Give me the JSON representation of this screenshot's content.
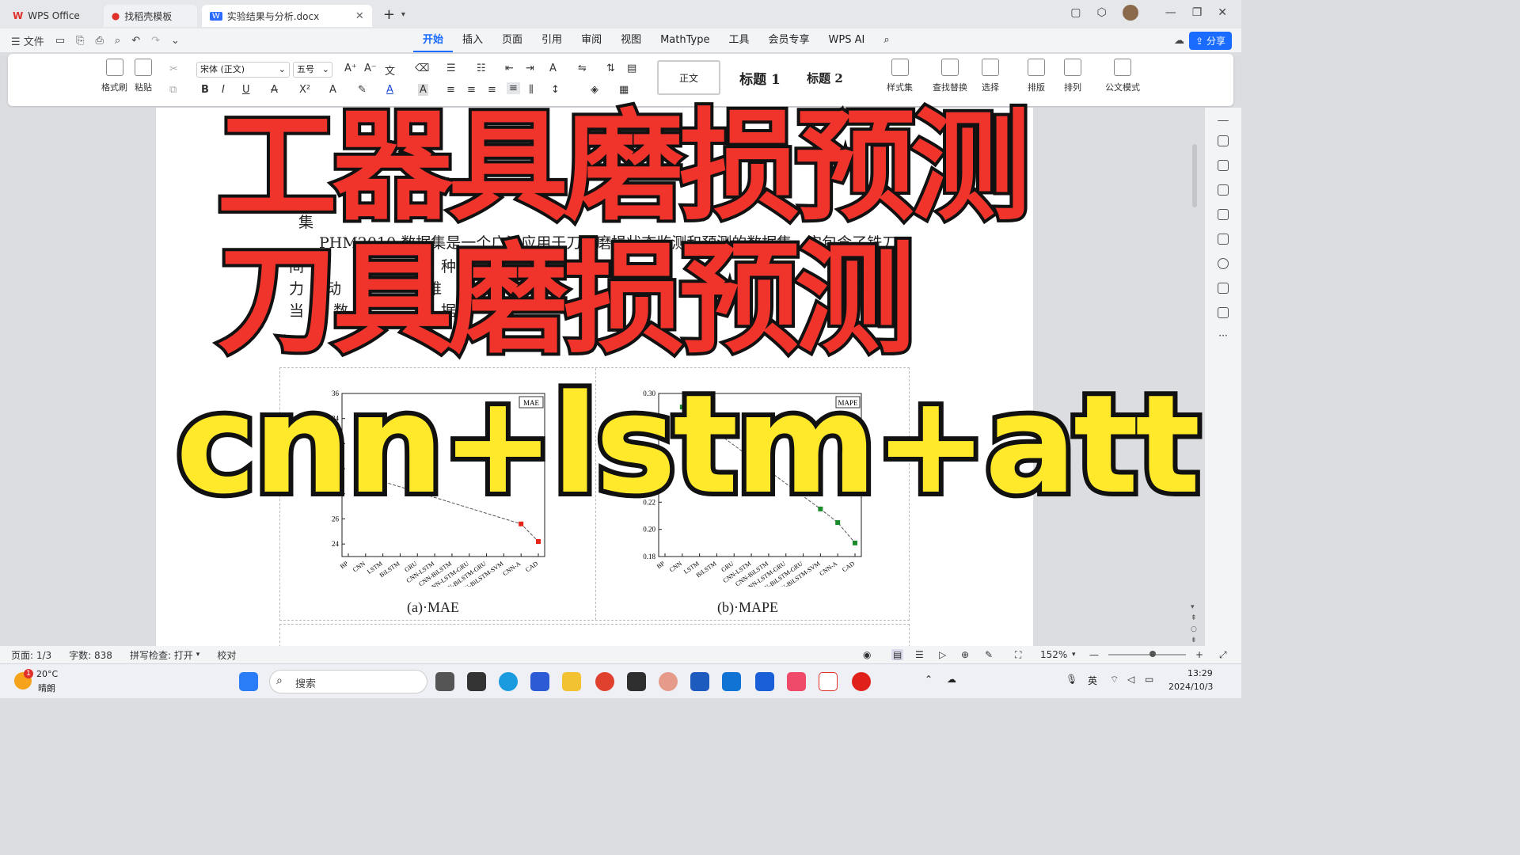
{
  "tabs": [
    {
      "label": "WPS Office"
    },
    {
      "label": "找稻壳模板"
    },
    {
      "label": "实验结果与分析.docx"
    }
  ],
  "menu": {
    "file": "文件",
    "tabs": [
      "开始",
      "插入",
      "页面",
      "引用",
      "审阅",
      "视图",
      "MathType",
      "工具",
      "会员专享",
      "WPS AI"
    ],
    "share": "分享"
  },
  "ribbon": {
    "format_painter": "格式刷",
    "paste": "粘贴",
    "font": "宋体 (正文)",
    "size": "五号",
    "styles": [
      "正文",
      "标题 1",
      "标题 2"
    ],
    "style_set": "样式集",
    "find_replace": "查找替换",
    "select": "选择",
    "layout": "排版",
    "arrange": "排列",
    "official": "公文模式"
  },
  "doc": {
    "line1": "PHM2010 数据集是一个广泛应用于刀具磨损状态监测和预测的数据集，它包含了铣刀",
    "line2_a": "间",
    "line2_b": "种",
    "line3_a": "力",
    "line3_b": "振动",
    "line3_c": "维",
    "line4_a": "当",
    "line4_b": "数",
    "line4_c": "据",
    "heading_frag": "集",
    "cap_a": "(a)·MAE",
    "cap_b": "(b)·MAPE"
  },
  "overlay": {
    "title1": "工器具磨损预测",
    "title2": "刀具磨损预测",
    "subtitle": "cnn+lstm+att"
  },
  "chart_data": [
    {
      "type": "line",
      "title": "",
      "legend": "MAE",
      "categories": [
        "BP",
        "CNN",
        "LSTM",
        "BiLSTM",
        "GRU",
        "CNN-LSTM",
        "CNN-BiLSTM",
        "CNN-LSTM-GRU",
        "CNN-BiLSTM-GRU",
        "CNN-BiLSTM-SVM",
        "CNN-A",
        "CAD"
      ],
      "yticks": [
        24,
        26,
        28,
        30,
        32,
        34,
        36
      ],
      "ylim": [
        23,
        36
      ],
      "visible_points": [
        {
          "x": "CNN",
          "y": 29.4
        },
        {
          "x": "CNN-A",
          "y": 25.6
        },
        {
          "x": "CAD",
          "y": 24.2
        }
      ]
    },
    {
      "type": "line",
      "title": "",
      "legend": "MAPE",
      "categories": [
        "BP",
        "CNN",
        "LSTM",
        "BiLSTM",
        "GRU",
        "CNN-LSTM",
        "CNN-BiLSTM",
        "CNN-LSTM-GRU",
        "CNN-BiLSTM-GRU",
        "CNN-BiLSTM-SVM",
        "CNN-A",
        "CAD"
      ],
      "yticks": [
        0.18,
        0.2,
        0.22,
        0.24,
        0.26,
        0.28,
        0.3
      ],
      "ylim": [
        0.18,
        0.3
      ],
      "visible_points": [
        {
          "x": "CNN",
          "y": 0.29
        },
        {
          "x": "CNN-BiLSTM-SVM",
          "y": 0.215
        },
        {
          "x": "CNN-A",
          "y": 0.205
        },
        {
          "x": "CAD",
          "y": 0.19
        }
      ]
    }
  ],
  "status": {
    "page": "页面: 1/3",
    "words": "字数: 838",
    "spell": "拼写检查: 打开",
    "proof": "校对",
    "zoom": "152%"
  },
  "taskbar": {
    "temp": "20°C",
    "weather": "晴朗",
    "search": "搜索",
    "time": "13:29",
    "date": "2024/10/3",
    "lang": "英"
  }
}
